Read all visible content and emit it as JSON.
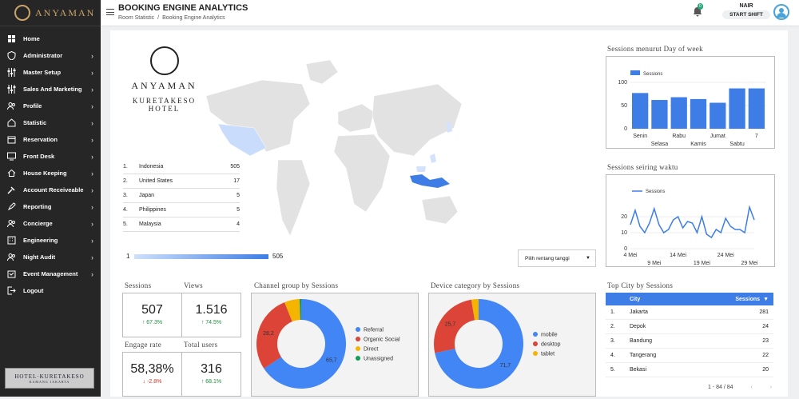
{
  "brand": "ANYAMAN",
  "sidebar": {
    "items": [
      {
        "label": "Home",
        "icon": "grid-icon",
        "chev": ""
      },
      {
        "label": "Administrator",
        "icon": "shield-icon",
        "chev": "›"
      },
      {
        "label": "Master Setup",
        "icon": "sliders-icon",
        "chev": "›"
      },
      {
        "label": "Sales And Marketing",
        "icon": "sliders-icon",
        "chev": "›"
      },
      {
        "label": "Profile",
        "icon": "users-icon",
        "chev": "›"
      },
      {
        "label": "Statistic",
        "icon": "home-icon",
        "chev": "›"
      },
      {
        "label": "Reservation",
        "icon": "calendar-icon",
        "chev": "›"
      },
      {
        "label": "Front Desk",
        "icon": "monitor-icon",
        "chev": "›"
      },
      {
        "label": "House Keeping",
        "icon": "house-icon",
        "chev": "›"
      },
      {
        "label": "Account Receiveable",
        "icon": "gavel-icon",
        "chev": "›"
      },
      {
        "label": "Reporting",
        "icon": "rocket-icon",
        "chev": "›"
      },
      {
        "label": "Concierge",
        "icon": "users-icon",
        "chev": "›"
      },
      {
        "label": "Engineering",
        "icon": "building-icon",
        "chev": "›"
      },
      {
        "label": "Night Audit",
        "icon": "users-icon",
        "chev": "›"
      },
      {
        "label": "Event Management",
        "icon": "event-icon",
        "chev": "›"
      },
      {
        "label": "Logout",
        "icon": "logout-icon",
        "chev": ""
      }
    ],
    "bottom_logo": "HOTEL·KURETAKESO",
    "bottom_logo_sub": "KAMANG JAKARTA"
  },
  "header": {
    "title": "BOOKING ENGINE ANALYTICS",
    "crumb1": "Room Statistic",
    "crumb_sep": "/",
    "crumb2": "Booking Engine Analytics",
    "notif_count": "0",
    "user": "NAIR",
    "shift": "START SHIFT"
  },
  "hotel": {
    "name": "ANYAMAN",
    "line2": "KURETAKESO",
    "line3": "HOTEL"
  },
  "countries": [
    {
      "n": "1.",
      "c": "Indonesia",
      "v": "505"
    },
    {
      "n": "2.",
      "c": "United States",
      "v": "17"
    },
    {
      "n": "3.",
      "c": "Japan",
      "v": "5"
    },
    {
      "n": "4.",
      "c": "Philippines",
      "v": "5"
    },
    {
      "n": "5.",
      "c": "Malaysia",
      "v": "4"
    }
  ],
  "map_scale": {
    "min": "1",
    "max": "505"
  },
  "date_range": "Pilih rentang tanggi",
  "titles": {
    "sessions": "Sessions",
    "views": "Views",
    "engage": "Engage rate",
    "total_users": "Total users",
    "channel": "Channel group by Sessions",
    "device": "Device category by Sessions",
    "city": "Top City by Sessions",
    "dow": "Sessions menurut Day of week",
    "time": "Sessions seiring waktu"
  },
  "scores": {
    "sessions": "507",
    "sessions_d": "↑ 67.3%",
    "views": "1.516",
    "views_d": "↑ 74.5%",
    "engage": "58,38%",
    "engage_d": "↓ -2.8%",
    "users": "316",
    "users_d": "↑ 68.1%"
  },
  "city": {
    "col1": "City",
    "col2": "Sessions",
    "rows": [
      {
        "n": "1.",
        "c": "Jakarta",
        "v": "281"
      },
      {
        "n": "2.",
        "c": "Depok",
        "v": "24"
      },
      {
        "n": "3.",
        "c": "Bandung",
        "v": "23"
      },
      {
        "n": "4.",
        "c": "Tangerang",
        "v": "22"
      },
      {
        "n": "5.",
        "c": "Bekasi",
        "v": "20"
      }
    ],
    "pager": "1 - 84 / 84"
  },
  "chart_data": [
    {
      "type": "bar",
      "title": "Sessions menurut Day of week",
      "legend": "Sessions",
      "categories": [
        "Senin",
        "Selasa",
        "Rabu",
        "Kamis",
        "Jumat",
        "Sabtu",
        "7"
      ],
      "tick_top": [
        "Senin",
        "",
        "Rabu",
        "",
        "Jumat",
        "",
        "7"
      ],
      "tick_bottom": [
        "",
        "Selasa",
        "",
        "Kamis",
        "",
        "Sabtu",
        ""
      ],
      "values": [
        77,
        62,
        68,
        64,
        56,
        87,
        87
      ],
      "ylim": [
        0,
        100
      ],
      "yticks": [
        "100",
        "50",
        "0"
      ]
    },
    {
      "type": "line",
      "title": "Sessions seiring waktu",
      "legend": "Sessions",
      "x": [
        "4 Mei",
        "5",
        "6",
        "7",
        "8",
        "9 Mei",
        "10",
        "11",
        "12",
        "13",
        "14 Mei",
        "15",
        "16",
        "17",
        "18",
        "19 Mei",
        "20",
        "21",
        "22",
        "23",
        "24 Mei",
        "25",
        "26",
        "27",
        "28",
        "29 Mei",
        "30"
      ],
      "values": [
        15,
        24,
        14,
        10,
        16,
        25,
        15,
        10,
        12,
        18,
        20,
        13,
        17,
        16,
        10,
        20,
        9,
        7,
        12,
        10,
        19,
        14,
        12,
        12,
        10,
        26,
        18
      ],
      "ylim": [
        0,
        30
      ],
      "yticks": [
        "20",
        "10",
        "0"
      ],
      "xtick_top": [
        "4 Mei",
        "14 Mei",
        "24 Mei"
      ],
      "xtick_bottom": [
        "9 Mei",
        "19 Mei",
        "29 Mei"
      ]
    },
    {
      "type": "pie",
      "title": "Channel group by Sessions",
      "labels": [
        "Referral",
        "Organic Social",
        "Direct",
        "Unassigned"
      ],
      "values": [
        65.7,
        28.2,
        5.5,
        0.6
      ],
      "colors": [
        "#4285f4",
        "#db4437",
        "#f4b400",
        "#0f9d58"
      ],
      "show_labels": [
        "65,7",
        "28,2"
      ]
    },
    {
      "type": "pie",
      "title": "Device category by Sessions",
      "labels": [
        "mobile",
        "desktop",
        "tablet"
      ],
      "values": [
        71.7,
        25.7,
        2.6
      ],
      "colors": [
        "#4285f4",
        "#db4437",
        "#f4b400"
      ],
      "show_labels": [
        "71,7",
        "25,7"
      ]
    }
  ]
}
